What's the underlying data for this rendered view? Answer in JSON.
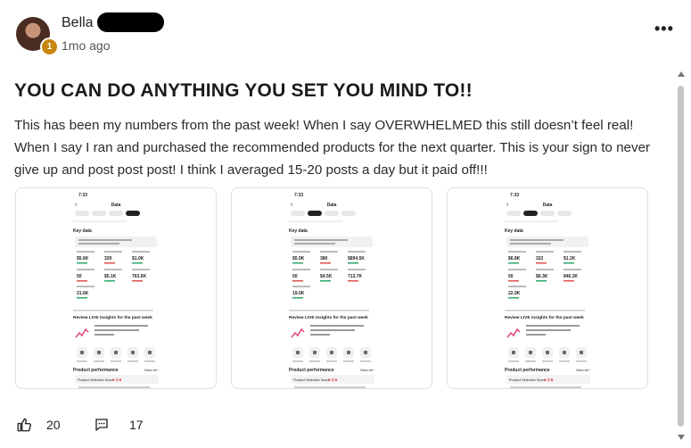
{
  "post": {
    "author": "Bella",
    "level": "1",
    "time": "1mo ago",
    "title": "YOU CAN DO ANYTHING YOU SET YOU MIND TO!!",
    "body": "This has been my numbers from the past week! When I say OVERWHELMED this still doesn’t feel real! When I say I ran and purchased the recommended products for the next quarter. This is your sign to never give up and post post post! I think I averaged 15-20 posts a day but it paid off!!!",
    "likes": "20",
    "comments": "17"
  },
  "icons": {
    "more": "more-options-icon",
    "like": "thumbs-up-icon",
    "comment": "comment-icon"
  },
  "screenshots": [
    {
      "time": "7:33",
      "header": "Data",
      "section": "Key data",
      "stats": [
        "$5.6K",
        "329",
        "$1.0K",
        "50",
        "$5.1K",
        "763.6K",
        "21.6K"
      ],
      "insights": "Review LIVE insights for the past week",
      "performance": "Product performance",
      "view_all": "View all",
      "score_label": "Product Selection Score",
      "score": "2.5"
    },
    {
      "time": "7:33",
      "header": "Data",
      "section": "Key data",
      "stats": [
        "$5.0K",
        "380",
        "$894.5K",
        "50",
        "$4.5K",
        "713.7K",
        "19.0K"
      ],
      "insights": "Review LIVE insights for the past week",
      "performance": "Product performance",
      "view_all": "View all",
      "score_label": "Product Selection Score",
      "score": "2.5"
    },
    {
      "time": "7:33",
      "header": "Data",
      "section": "Key data",
      "stats": [
        "$6.8K",
        "322",
        "$1.2K",
        "50",
        "$6.3K",
        "846.3K",
        "22.9K"
      ],
      "insights": "Review LIVE insights for the past week",
      "performance": "Product performance",
      "view_all": "View all",
      "score_label": "Product Selection Score",
      "score": "2.5"
    }
  ]
}
